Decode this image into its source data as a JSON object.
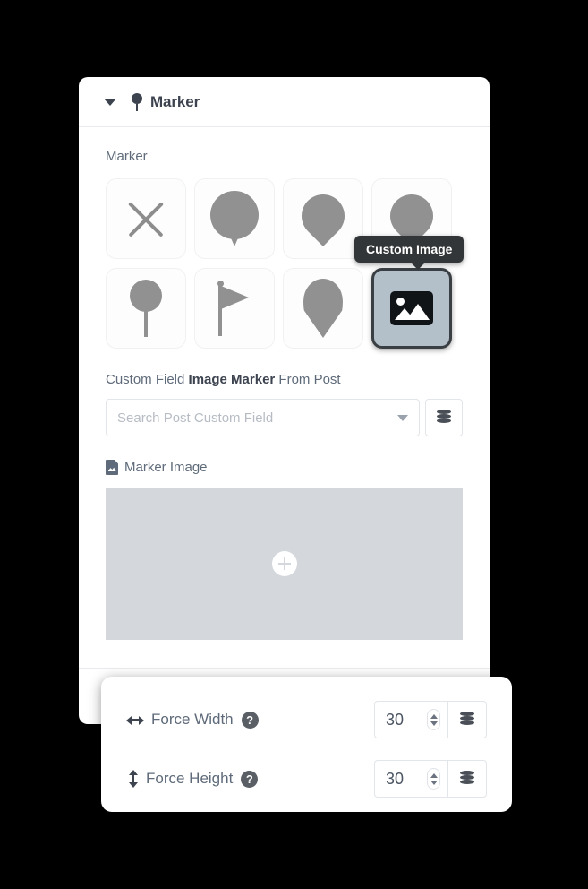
{
  "panel": {
    "title": "Marker",
    "title_icon": "map-pin-icon",
    "collapse_icon": "chevron-down-icon",
    "section_label": "Marker"
  },
  "marker_options": [
    {
      "id": "none",
      "icon": "x-cross-icon",
      "selected": false
    },
    {
      "id": "balloon",
      "icon": "balloon-marker-icon",
      "selected": false
    },
    {
      "id": "teardrop",
      "icon": "teardrop-pin-icon",
      "selected": false
    },
    {
      "id": "teardrop-2",
      "icon": "teardrop-pin-icon",
      "selected": false
    },
    {
      "id": "lollipop",
      "icon": "lollipop-pin-icon",
      "selected": false
    },
    {
      "id": "flag",
      "icon": "flag-marker-icon",
      "selected": false
    },
    {
      "id": "drop-long",
      "icon": "long-teardrop-icon",
      "selected": false
    },
    {
      "id": "custom-image",
      "icon": "image-icon",
      "selected": true
    }
  ],
  "tooltip": {
    "text": "Custom Image",
    "background": "#333638",
    "color": "#ffffff"
  },
  "custom_field": {
    "label_prefix": "Custom Field ",
    "label_strong": "Image Marker",
    "label_suffix": " From Post",
    "select_placeholder": "Search Post Custom Field",
    "select_value": "",
    "caret_icon": "caret-down-icon",
    "dynamic_icon": "database-stack-icon"
  },
  "marker_image": {
    "label": "Marker Image",
    "label_icon": "file-image-icon",
    "dropzone_icon": "plus-circle-icon",
    "dropzone_background": "#d4d8dc"
  },
  "force_fields": [
    {
      "label": "Force Width",
      "icon": "arrows-horizontal-icon",
      "help_icon": "question-mark-icon",
      "help_text": "?",
      "value": "30",
      "spinner_icon": "spinner-updown-icon",
      "dynamic_icon": "database-stack-icon"
    },
    {
      "label": "Force Height",
      "icon": "arrows-vertical-icon",
      "help_icon": "question-mark-icon",
      "help_text": "?",
      "value": "30",
      "spinner_icon": "spinner-updown-icon",
      "dynamic_icon": "database-stack-icon"
    }
  ],
  "colors": {
    "background": "#000000",
    "panel": "#ffffff",
    "text": "#5f6b7a",
    "heading": "#3d4450",
    "marker_glyph": "#919191",
    "selected_tile": "#b3bfc9",
    "selected_border": "#3a3f44"
  }
}
